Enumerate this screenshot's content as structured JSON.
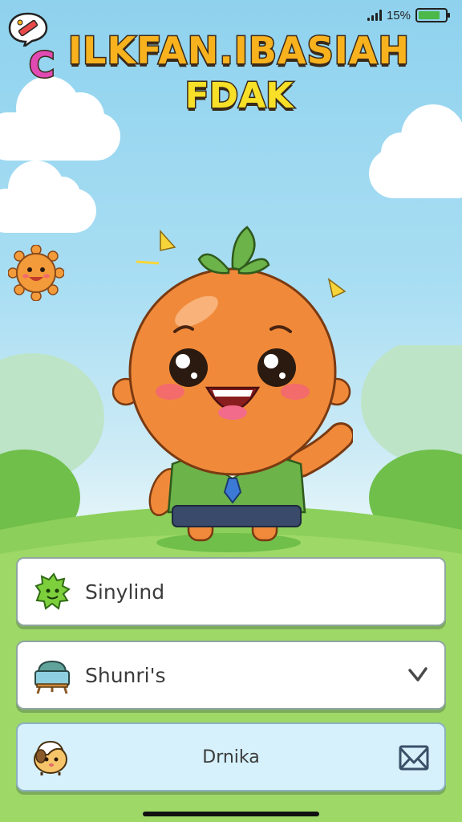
{
  "status_bar": {
    "battery_text": "15%",
    "battery_level": 0.8
  },
  "title": {
    "first_letter": "C",
    "line1": "ILKFAN.IBASIAH",
    "line2": "FDAK"
  },
  "menu": {
    "items": [
      {
        "label": "Sinylind",
        "icon": "green-blob-icon"
      },
      {
        "label": "Shunri's",
        "icon": "easel-icon"
      },
      {
        "label": "Drnika",
        "icon": "hamster-icon"
      }
    ]
  },
  "colors": {
    "accent": "#f7b21e",
    "grass": "#8ccf5a",
    "sky": "#a9def3"
  }
}
